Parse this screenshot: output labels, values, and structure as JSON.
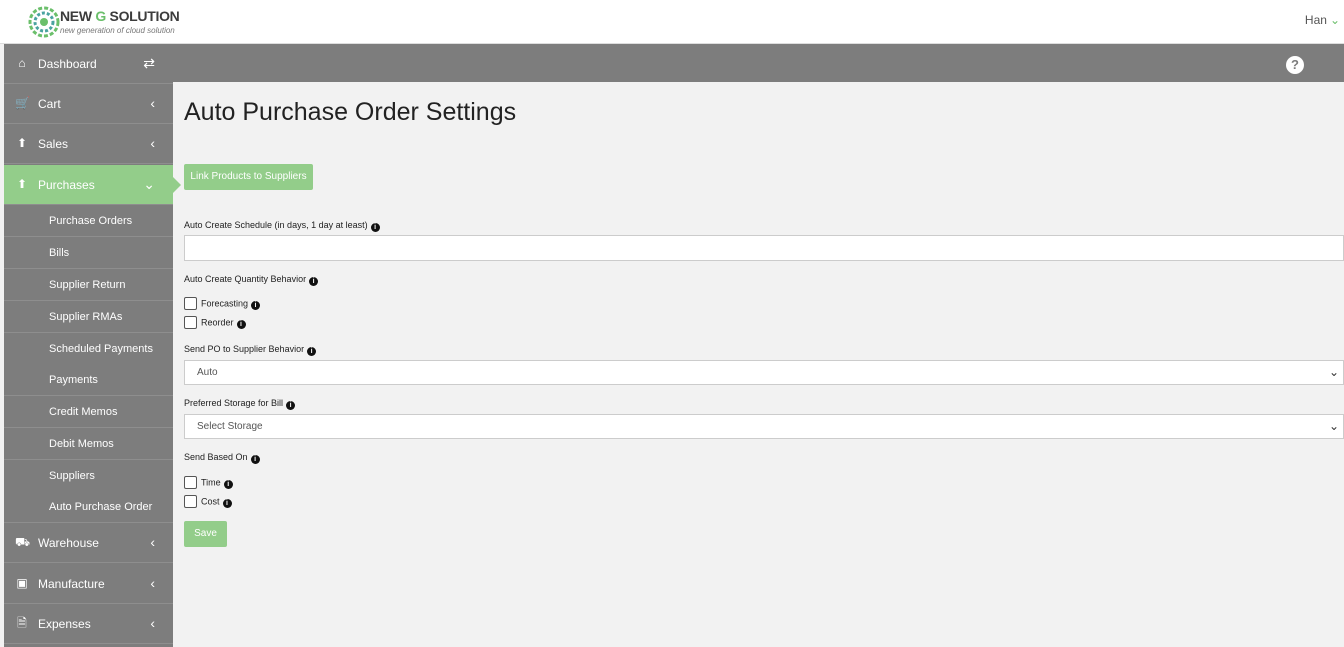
{
  "header": {
    "brand_prefix": "NEW ",
    "brand_g": "G",
    "brand_suffix": " SOLUTION",
    "tagline": "new generation of cloud solution",
    "user_name": "Han",
    "help_glyph": "?"
  },
  "sidebar": {
    "dashboard": {
      "label": "Dashboard",
      "icon": "home-icon"
    },
    "cart": {
      "label": "Cart",
      "icon": "cart-icon"
    },
    "sales": {
      "label": "Sales",
      "icon": "upload-icon"
    },
    "purchases": {
      "label": "Purchases",
      "icon": "upload-icon"
    },
    "sub_items": [
      "Purchase Orders",
      "Bills",
      "Supplier Return",
      "Supplier RMAs",
      "Scheduled Payments",
      "Payments",
      "Credit Memos",
      "Debit Memos",
      "Suppliers",
      "Auto Purchase Order"
    ],
    "warehouse": {
      "label": "Warehouse",
      "icon": "truck-icon"
    },
    "manufacture": {
      "label": "Manufacture",
      "icon": "factory-icon"
    },
    "expenses": {
      "label": "Expenses",
      "icon": "file-icon"
    }
  },
  "main": {
    "title": "Auto Purchase Order Settings",
    "link_button": "Link Products to Suppliers",
    "schedule_label": "Auto Create Schedule (in days, 1 day at least)",
    "schedule_value": "",
    "quantity_label": "Auto Create Quantity Behavior",
    "forecasting": "Forecasting",
    "reorder": "Reorder",
    "send_po_label": "Send PO to Supplier Behavior",
    "send_po_value": "Auto",
    "storage_label": "Preferred Storage for Bill",
    "storage_value": "Select Storage",
    "send_based_label": "Send Based On",
    "time": "Time",
    "cost": "Cost",
    "save": "Save"
  },
  "colors": {
    "accent": "#93cd8a",
    "sidebar": "#7d7d7d"
  }
}
